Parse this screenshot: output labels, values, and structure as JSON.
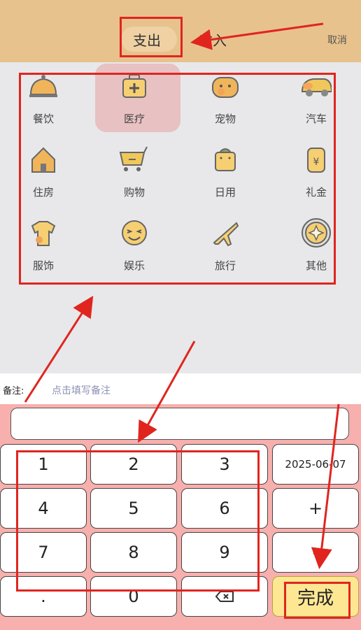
{
  "header": {
    "tabs": [
      "支出",
      "收入"
    ],
    "cancel_label": "取消"
  },
  "categories": [
    {
      "label": "餐饮",
      "icon": "dining-cloche-icon",
      "selected": false
    },
    {
      "label": "医疗",
      "icon": "medical-kit-icon",
      "selected": true
    },
    {
      "label": "宠物",
      "icon": "pet-icon",
      "selected": false
    },
    {
      "label": "汽车",
      "icon": "car-icon",
      "selected": false
    },
    {
      "label": "住房",
      "icon": "house-icon",
      "selected": false
    },
    {
      "label": "购物",
      "icon": "shopping-cart-icon",
      "selected": false
    },
    {
      "label": "日用",
      "icon": "daily-bag-icon",
      "selected": false
    },
    {
      "label": "礼金",
      "icon": "gift-money-icon",
      "selected": false
    },
    {
      "label": "服饰",
      "icon": "clothing-icon",
      "selected": false
    },
    {
      "label": "娱乐",
      "icon": "smiley-icon",
      "selected": false
    },
    {
      "label": "旅行",
      "icon": "airplane-icon",
      "selected": false
    },
    {
      "label": "其他",
      "icon": "other-icon",
      "selected": false
    }
  ],
  "remark": {
    "label": "备注:",
    "placeholder": "点击填写备注"
  },
  "amount": {
    "value": ""
  },
  "keypad": {
    "rows": [
      [
        "1",
        "2",
        "3",
        "2025-06-07"
      ],
      [
        "4",
        "5",
        "6",
        "+"
      ],
      [
        "7",
        "8",
        "9",
        "-"
      ],
      [
        ".",
        "0",
        "",
        "完成"
      ]
    ]
  },
  "colors": {
    "header_bg": "#e8c28d",
    "keypad_bg": "#f7b0ad",
    "done_bg": "#fde793",
    "annotation": "#e0251f"
  }
}
